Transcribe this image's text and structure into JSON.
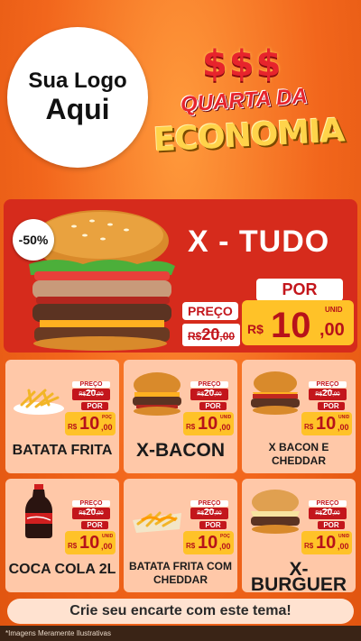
{
  "header": {
    "logo_line1": "Sua Logo",
    "logo_line2": "Aqui",
    "symbols": "$$$",
    "title_line1": "QUARTA DA",
    "title_line2": "ECONOMIA"
  },
  "hero": {
    "discount": "-50%",
    "name": "X - TUDO",
    "preco_label": "PREÇO",
    "old_currency": "R$",
    "old_price": "20",
    "old_cents": ",00",
    "por_label": "POR",
    "currency": "R$",
    "price_int": "10",
    "price_dec": ",00",
    "unit": "UNID"
  },
  "products": [
    {
      "name": "BATATA FRITA",
      "unit": "POÇ",
      "picture": "fries"
    },
    {
      "name": "X-BACON",
      "unit": "UNID",
      "picture": "burger"
    },
    {
      "name": "X BACON E CHEDDAR",
      "unit": "UNID",
      "picture": "burger-cheddar"
    },
    {
      "name": "COCA COLA 2L",
      "unit": "UNID",
      "picture": "soda-bottle"
    },
    {
      "name": "BATATA FRITA COM CHEDDAR",
      "unit": "POÇ",
      "picture": "fries-cheddar"
    },
    {
      "name": "X-BURGUER",
      "unit": "UNID",
      "picture": "burger-cheese"
    }
  ],
  "price_tag": {
    "preco_label": "PREÇO",
    "old_currency": "R$",
    "old_price": "20",
    "old_cents": ",00",
    "por_label": "POR",
    "currency": "R$",
    "price_int": "10",
    "price_dec": ",00"
  },
  "footer": {
    "cta": "Crie seu encarte com este tema!",
    "disclaimer": "*Imagens Meramente Ilustrativas"
  },
  "colors": {
    "background": "#f2661c",
    "hero": "#d62b1c",
    "card": "#ffc8a8",
    "price_box": "#ffc228",
    "accent_red": "#c3161c"
  }
}
